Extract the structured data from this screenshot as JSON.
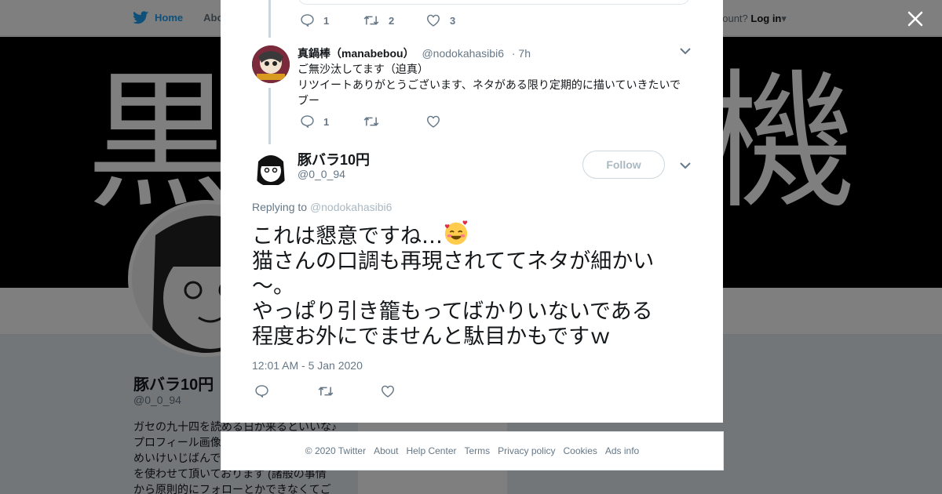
{
  "background": {
    "nav": {
      "home": "Home",
      "about": "Abo",
      "account_prompt": "account?",
      "login": "Log in"
    },
    "banner": {
      "char1": "黒",
      "char2": "機"
    },
    "profile": {
      "name": "豚バラ10円",
      "handle": "@0_0_94",
      "bio_lines": [
        "ガセの九十四を読める日が来るといいな♪",
        "プロフィール画像",
        "めいけいじばんで",
        "を使わせて頂いております (諸般の事情",
        "から原則的にフォローとかできなくてご"
      ]
    },
    "ads_text": "Ads info"
  },
  "previous_tweet": {
    "reply_count": "1",
    "retweet_count": "2",
    "like_count": "3"
  },
  "reply_tweet": {
    "name": "真鍋棒（manabebou）",
    "handle": "@nodokahasibi6",
    "time": "· 7h",
    "lines": [
      "ご無沙汰してます（迫真）",
      "リツイートありがとうございます、ネタがある限り定期的に描いていきたいで",
      "ブー"
    ],
    "reply_count": "1"
  },
  "main_tweet": {
    "name": "豚バラ10円",
    "handle": "@0_0_94",
    "follow_label": "Follow",
    "replying_prefix": "Replying to",
    "replying_to": "@nodokahasibi6",
    "text_lines": [
      "これは懇意ですね…",
      "猫さんの口調も再現されててネタが細かい",
      "～。",
      "やっぱり引き籠もってばかりいないである",
      "程度お外にでませんと駄目かもですｗ"
    ],
    "emoji": "smiling-face-with-hearts",
    "timestamp": "12:01 AM - 5 Jan 2020"
  },
  "footer": {
    "links": [
      "© 2020 Twitter",
      "About",
      "Help Center",
      "Terms",
      "Privacy policy",
      "Cookies",
      "Ads info"
    ]
  },
  "colors": {
    "twitter_blue": "#1da1f2",
    "text": "#14171a",
    "muted": "#657786",
    "border": "#e1e8ed"
  }
}
